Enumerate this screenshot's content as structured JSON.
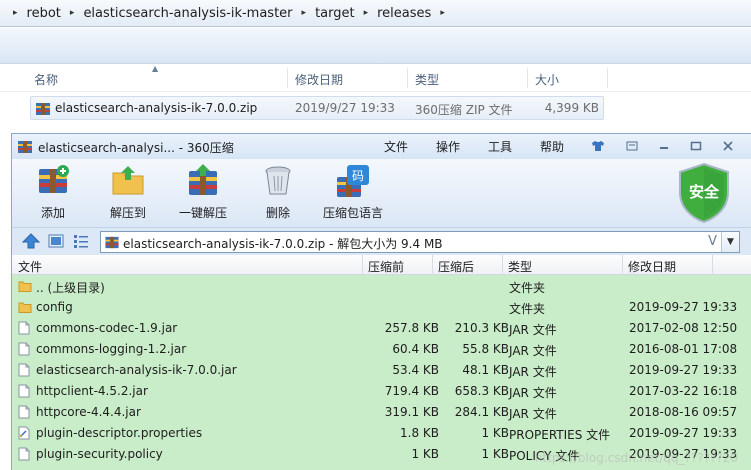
{
  "explorer": {
    "breadcrumb": [
      "rebot",
      "elasticsearch-analysis-ik-master",
      "target",
      "releases"
    ],
    "columns": {
      "name": "名称",
      "modified": "修改日期",
      "type": "类型",
      "size": "大小"
    },
    "file": {
      "name": "elasticsearch-analysis-ik-7.0.0.zip",
      "modified": "2019/9/27 19:33",
      "type": "360压缩 ZIP 文件",
      "size": "4,399 KB"
    }
  },
  "zip_window": {
    "title": "elasticsearch-analysi... - 360压缩",
    "menu": [
      "文件",
      "操作",
      "工具",
      "帮助"
    ],
    "toolbar": {
      "add": "添加",
      "extract_to": "解压到",
      "one_click_extract": "一键解压",
      "delete": "删除",
      "comment": "压缩包语言"
    },
    "security_badge": "安全",
    "path": "elasticsearch-analysis-ik-7.0.0.zip - 解包大小为 9.4 MB",
    "path_v": "V",
    "columns": {
      "name": "文件",
      "original_size": "压缩前",
      "compressed_size": "压缩后",
      "type": "类型",
      "modified": "修改日期"
    },
    "rows": [
      {
        "icon": "folder-up-icon",
        "name": ".. (上级目录)",
        "orig": "",
        "comp": "",
        "type": "文件夹",
        "date": ""
      },
      {
        "icon": "folder-icon",
        "name": "config",
        "orig": "",
        "comp": "",
        "type": "文件夹",
        "date": "2019-09-27 19:33"
      },
      {
        "icon": "file-icon",
        "name": "commons-codec-1.9.jar",
        "orig": "257.8 KB",
        "comp": "210.3 KB",
        "type": "JAR 文件",
        "date": "2017-02-08 12:50"
      },
      {
        "icon": "file-icon",
        "name": "commons-logging-1.2.jar",
        "orig": "60.4 KB",
        "comp": "55.8 KB",
        "type": "JAR 文件",
        "date": "2016-08-01 17:08"
      },
      {
        "icon": "file-icon",
        "name": "elasticsearch-analysis-ik-7.0.0.jar",
        "orig": "53.4 KB",
        "comp": "48.1 KB",
        "type": "JAR 文件",
        "date": "2019-09-27 19:33"
      },
      {
        "icon": "file-icon",
        "name": "httpclient-4.5.2.jar",
        "orig": "719.4 KB",
        "comp": "658.3 KB",
        "type": "JAR 文件",
        "date": "2017-03-22 16:18"
      },
      {
        "icon": "file-icon",
        "name": "httpcore-4.4.4.jar",
        "orig": "319.1 KB",
        "comp": "284.1 KB",
        "type": "JAR 文件",
        "date": "2018-08-16 09:57"
      },
      {
        "icon": "properties-file-icon",
        "name": "plugin-descriptor.properties",
        "orig": "1.8 KB",
        "comp": "1 KB",
        "type": "PROPERTIES 文件",
        "date": "2019-09-27 19:33"
      },
      {
        "icon": "file-icon",
        "name": "plugin-security.policy",
        "orig": "1 KB",
        "comp": "1 KB",
        "type": "POLICY 文件",
        "date": "2019-09-27 19:33"
      }
    ],
    "watermark": "https://blog.csdn.net/qq_??????20"
  }
}
